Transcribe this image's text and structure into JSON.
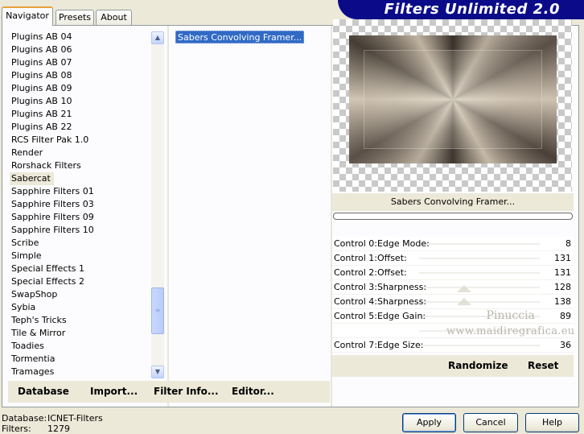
{
  "tabs": [
    {
      "label": "Navigator",
      "active": true
    },
    {
      "label": "Presets",
      "active": false
    },
    {
      "label": "About",
      "active": false
    }
  ],
  "banner_title": "Filters Unlimited 2.0",
  "categories": [
    {
      "label": "Plugins AB 04"
    },
    {
      "label": "Plugins AB 06"
    },
    {
      "label": "Plugins AB 07"
    },
    {
      "label": "Plugins AB 08"
    },
    {
      "label": "Plugins AB 09"
    },
    {
      "label": "Plugins AB 10"
    },
    {
      "label": "Plugins AB 21"
    },
    {
      "label": "Plugins AB 22"
    },
    {
      "label": "RCS Filter Pak 1.0"
    },
    {
      "label": "Render"
    },
    {
      "label": "Rorshack Filters"
    },
    {
      "label": "Sabercat",
      "selected": true
    },
    {
      "label": "Sapphire Filters 01"
    },
    {
      "label": "Sapphire Filters 03"
    },
    {
      "label": "Sapphire Filters 09"
    },
    {
      "label": "Sapphire Filters 10"
    },
    {
      "label": "Scribe"
    },
    {
      "label": "Simple"
    },
    {
      "label": "Special Effects 1"
    },
    {
      "label": "Special Effects 2"
    },
    {
      "label": "SwapShop"
    },
    {
      "label": "Sybia"
    },
    {
      "label": "Teph's Tricks"
    },
    {
      "label": "Tile & Mirror"
    },
    {
      "label": "Toadies"
    },
    {
      "label": "Tormentia"
    },
    {
      "label": "Tramages"
    }
  ],
  "filters": [
    {
      "label": "Sabers Convolving Framer...",
      "selected": true
    }
  ],
  "preview": {
    "filter_name": "Sabers Convolving Framer...",
    "progress": 0
  },
  "controls": [
    {
      "label": "Control 0:Edge Mode:",
      "value": "8"
    },
    {
      "label": "Control 1:Offset:",
      "value": "131"
    },
    {
      "label": "Control 2:Offset:",
      "value": "131"
    },
    {
      "label": "Control 3:Sharpness:",
      "value": "128"
    },
    {
      "label": "Control 4:Sharpness:",
      "value": "138"
    },
    {
      "label": "Control 5:Edge Gain:",
      "value": "89"
    },
    {
      "label": "",
      "value": ""
    },
    {
      "label": "Control 7:Edge Size:",
      "value": "36"
    }
  ],
  "watermark": {
    "line1": "Pinuccia",
    "line2": "www.maidiregrafica.eu"
  },
  "left_actions": {
    "database": "Database",
    "import": "Import...",
    "filter_info": "Filter Info...",
    "editor": "Editor..."
  },
  "right_actions": {
    "randomize": "Randomize",
    "reset": "Reset"
  },
  "status": {
    "database_label": "Database:",
    "database_value": "ICNET-Filters",
    "filters_label": "Filters:",
    "filters_value": "1279"
  },
  "buttons": {
    "apply": "Apply",
    "cancel": "Cancel",
    "help": "Help"
  },
  "colors": {
    "banner": "#0b0b8a",
    "selection": "#316ac5",
    "window_bg": "#ece9d8"
  }
}
